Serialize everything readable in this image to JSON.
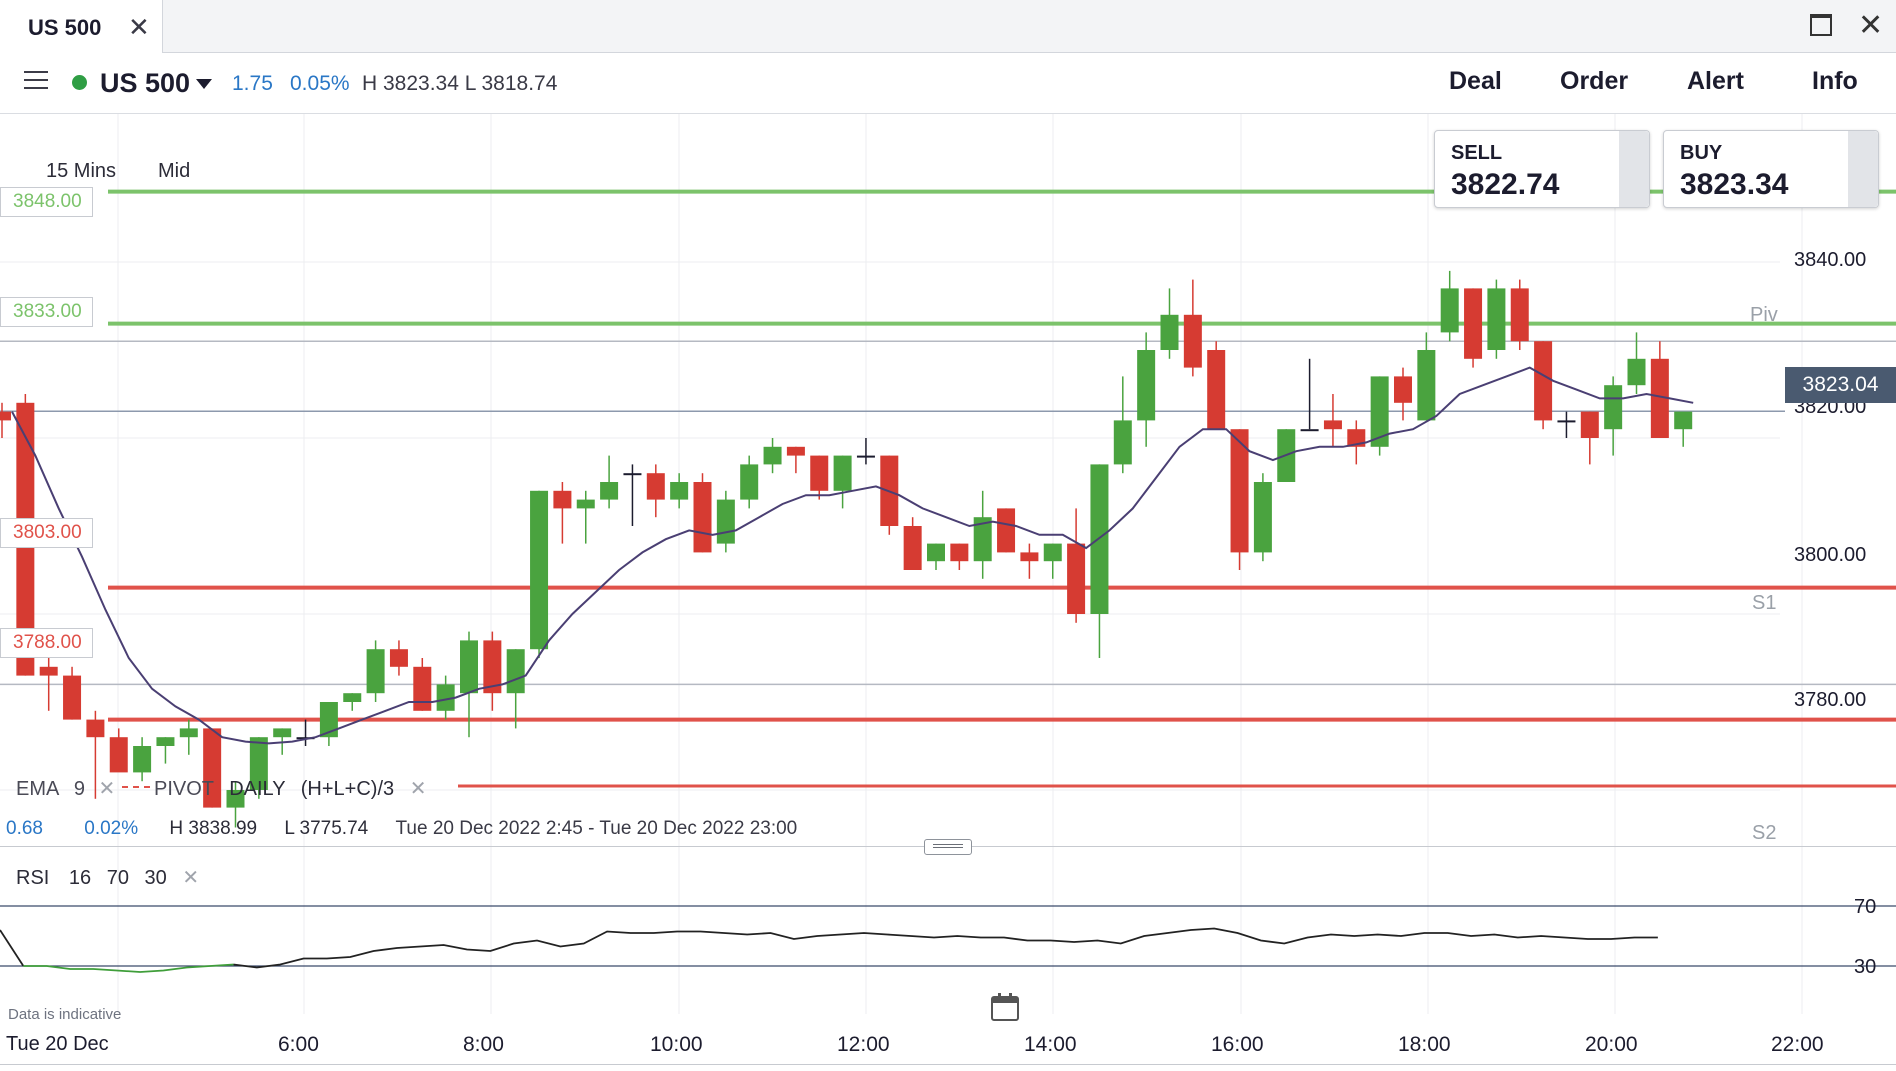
{
  "tab": {
    "title": "US 500"
  },
  "header": {
    "instrument": "US 500",
    "change_points": "1.75",
    "change_percent": "0.05%",
    "high_low": "H 3823.34 L 3818.74",
    "actions": [
      "Deal",
      "Order",
      "Alert",
      "Info"
    ]
  },
  "chart_toolbar": {
    "interval": "15 Mins",
    "price_type": "Mid"
  },
  "tickets": {
    "sell": {
      "label": "SELL",
      "price": "3822.74"
    },
    "buy": {
      "label": "BUY",
      "price": "3823.34"
    }
  },
  "levels": {
    "green": [
      "3848.00",
      "3833.00"
    ],
    "red": [
      "3803.00",
      "3788.00"
    ],
    "pivots": [
      "Piv",
      "S1",
      "S2"
    ]
  },
  "current_price": "3823.04",
  "price_axis": [
    "3840.00",
    "3820.00",
    "3800.00",
    "3780.00"
  ],
  "indicators": {
    "ema": {
      "name": "EMA",
      "period": "9"
    },
    "pivot": {
      "name": "PIVOT",
      "period": "DAILY",
      "formula": "(H+L+C)/3"
    }
  },
  "stats": {
    "change": "0.68",
    "change_pct": "0.02%",
    "high": "H 3838.99",
    "low": "L 3775.74",
    "range": "Tue 20 Dec 2022 2:45 - Tue 20 Dec 2022 23:00"
  },
  "rsi": {
    "name": "RSI",
    "params": [
      "16",
      "70",
      "30"
    ],
    "levels": [
      "70",
      "30"
    ]
  },
  "footer": {
    "note": "Data is indicative",
    "date": "Tue 20 Dec",
    "times": [
      "6:00",
      "8:00",
      "10:00",
      "12:00",
      "14:00",
      "16:00",
      "18:00",
      "20:00",
      "22:00"
    ]
  },
  "colors": {
    "up": "#4aa33f",
    "down": "#d63b32",
    "green_level": "#7cc36b",
    "red_level": "#e0524a",
    "ema": "#4a3f73",
    "rsi": "#222222",
    "rsi_low": "#3f9e3a",
    "accent_blue": "#2a77c6"
  },
  "chart_data": {
    "type": "candlestick",
    "interval": "15 Mins",
    "ylim": [
      3762,
      3852
    ],
    "candles": [
      {
        "o": 3823,
        "h": 3824,
        "l": 3820,
        "c": 3822
      },
      {
        "o": 3824,
        "h": 3825,
        "l": 3793,
        "c": 3793
      },
      {
        "o": 3794,
        "h": 3796,
        "l": 3789,
        "c": 3793
      },
      {
        "o": 3793,
        "h": 3794,
        "l": 3788,
        "c": 3788
      },
      {
        "o": 3788,
        "h": 3789,
        "l": 3779,
        "c": 3786
      },
      {
        "o": 3786,
        "h": 3787,
        "l": 3783,
        "c": 3782
      },
      {
        "o": 3782,
        "h": 3786,
        "l": 3781,
        "c": 3785
      },
      {
        "o": 3785,
        "h": 3786,
        "l": 3783,
        "c": 3786
      },
      {
        "o": 3786,
        "h": 3788,
        "l": 3784,
        "c": 3787
      },
      {
        "o": 3787,
        "h": 3787,
        "l": 3778,
        "c": 3778
      },
      {
        "o": 3778,
        "h": 3781,
        "l": 3775.74,
        "c": 3780
      },
      {
        "o": 3780,
        "h": 3786,
        "l": 3779,
        "c": 3786
      },
      {
        "o": 3786,
        "h": 3787,
        "l": 3784,
        "c": 3787
      },
      {
        "o": 3786,
        "h": 3788,
        "l": 3785,
        "c": 3786
      },
      {
        "o": 3786,
        "h": 3790,
        "l": 3785,
        "c": 3790
      },
      {
        "o": 3790,
        "h": 3791,
        "l": 3789,
        "c": 3791
      },
      {
        "o": 3791,
        "h": 3797,
        "l": 3790,
        "c": 3796
      },
      {
        "o": 3796,
        "h": 3797,
        "l": 3793,
        "c": 3794
      },
      {
        "o": 3794,
        "h": 3795,
        "l": 3789,
        "c": 3789
      },
      {
        "o": 3789,
        "h": 3793,
        "l": 3788,
        "c": 3792
      },
      {
        "o": 3791,
        "h": 3798,
        "l": 3786,
        "c": 3797
      },
      {
        "o": 3797,
        "h": 3798,
        "l": 3789,
        "c": 3791
      },
      {
        "o": 3791,
        "h": 3796,
        "l": 3787,
        "c": 3796
      },
      {
        "o": 3796,
        "h": 3814,
        "l": 3795,
        "c": 3814
      },
      {
        "o": 3814,
        "h": 3815,
        "l": 3808,
        "c": 3812
      },
      {
        "o": 3812,
        "h": 3814,
        "l": 3808,
        "c": 3813
      },
      {
        "o": 3813,
        "h": 3818,
        "l": 3812,
        "c": 3815
      },
      {
        "o": 3816,
        "h": 3817,
        "l": 3810,
        "c": 3816
      },
      {
        "o": 3816,
        "h": 3817,
        "l": 3811,
        "c": 3813
      },
      {
        "o": 3813,
        "h": 3816,
        "l": 3812,
        "c": 3815
      },
      {
        "o": 3815,
        "h": 3816,
        "l": 3807,
        "c": 3807
      },
      {
        "o": 3808,
        "h": 3814,
        "l": 3807,
        "c": 3813
      },
      {
        "o": 3813,
        "h": 3818,
        "l": 3812,
        "c": 3817
      },
      {
        "o": 3817,
        "h": 3820,
        "l": 3816,
        "c": 3819
      },
      {
        "o": 3819,
        "h": 3819,
        "l": 3816,
        "c": 3818
      },
      {
        "o": 3818,
        "h": 3818,
        "l": 3813,
        "c": 3814
      },
      {
        "o": 3814,
        "h": 3818,
        "l": 3812,
        "c": 3818
      },
      {
        "o": 3818,
        "h": 3820,
        "l": 3817,
        "c": 3818
      },
      {
        "o": 3818,
        "h": 3818,
        "l": 3809,
        "c": 3810
      },
      {
        "o": 3810,
        "h": 3811,
        "l": 3805,
        "c": 3805
      },
      {
        "o": 3806,
        "h": 3808,
        "l": 3805,
        "c": 3808
      },
      {
        "o": 3808,
        "h": 3808,
        "l": 3805,
        "c": 3806
      },
      {
        "o": 3806,
        "h": 3814,
        "l": 3804,
        "c": 3811
      },
      {
        "o": 3812,
        "h": 3812,
        "l": 3807,
        "c": 3807
      },
      {
        "o": 3807,
        "h": 3808,
        "l": 3804,
        "c": 3806
      },
      {
        "o": 3806,
        "h": 3808,
        "l": 3804,
        "c": 3808
      },
      {
        "o": 3808,
        "h": 3812,
        "l": 3799,
        "c": 3800
      },
      {
        "o": 3800,
        "h": 3817,
        "l": 3795,
        "c": 3817
      },
      {
        "o": 3817,
        "h": 3827,
        "l": 3816,
        "c": 3822
      },
      {
        "o": 3822,
        "h": 3832,
        "l": 3819,
        "c": 3830
      },
      {
        "o": 3830,
        "h": 3837,
        "l": 3829,
        "c": 3834
      },
      {
        "o": 3834,
        "h": 3838,
        "l": 3827,
        "c": 3828
      },
      {
        "o": 3830,
        "h": 3831,
        "l": 3821,
        "c": 3821
      },
      {
        "o": 3821,
        "h": 3821,
        "l": 3805,
        "c": 3807
      },
      {
        "o": 3807,
        "h": 3816,
        "l": 3806,
        "c": 3815
      },
      {
        "o": 3815,
        "h": 3821,
        "l": 3815,
        "c": 3821
      },
      {
        "o": 3821,
        "h": 3829,
        "l": 3821,
        "c": 3821
      },
      {
        "o": 3822,
        "h": 3825,
        "l": 3819,
        "c": 3821
      },
      {
        "o": 3821,
        "h": 3822,
        "l": 3817,
        "c": 3819
      },
      {
        "o": 3819,
        "h": 3827,
        "l": 3818,
        "c": 3827
      },
      {
        "o": 3827,
        "h": 3828,
        "l": 3822,
        "c": 3824
      },
      {
        "o": 3822,
        "h": 3832,
        "l": 3822,
        "c": 3830
      },
      {
        "o": 3832,
        "h": 3838.99,
        "l": 3831,
        "c": 3837
      },
      {
        "o": 3837,
        "h": 3837,
        "l": 3828,
        "c": 3829
      },
      {
        "o": 3830,
        "h": 3838,
        "l": 3829,
        "c": 3837
      },
      {
        "o": 3837,
        "h": 3838,
        "l": 3830,
        "c": 3831
      },
      {
        "o": 3831,
        "h": 3831,
        "l": 3821,
        "c": 3822
      },
      {
        "o": 3822,
        "h": 3823,
        "l": 3820,
        "c": 3822
      },
      {
        "o": 3823,
        "h": 3823,
        "l": 3817,
        "c": 3820
      },
      {
        "o": 3821,
        "h": 3827,
        "l": 3818,
        "c": 3826
      },
      {
        "o": 3826,
        "h": 3832,
        "l": 3825,
        "c": 3829
      },
      {
        "o": 3829,
        "h": 3831,
        "l": 3821,
        "c": 3820
      },
      {
        "o": 3821,
        "h": 3822,
        "l": 3819,
        "c": 3823
      }
    ],
    "ema_9": [
      3823,
      3818,
      3812,
      3806.5,
      3800.5,
      3795,
      3791.5,
      3789.5,
      3788,
      3786,
      3785.5,
      3785.3,
      3785.5,
      3786,
      3787,
      3788,
      3789,
      3790,
      3790,
      3790.5,
      3791.5,
      3792,
      3793,
      3797,
      3800,
      3802.5,
      3805,
      3807,
      3808.5,
      3809.5,
      3809,
      3809.5,
      3811,
      3812.5,
      3813.5,
      3813.5,
      3814,
      3814.5,
      3813.5,
      3812,
      3811,
      3810,
      3810.5,
      3810,
      3809,
      3809,
      3807.5,
      3809.5,
      3812,
      3815.5,
      3819,
      3821,
      3821,
      3818.5,
      3817.5,
      3818.5,
      3819,
      3819,
      3819.5,
      3820.5,
      3821,
      3822.5,
      3825,
      3826,
      3827,
      3828,
      3826.5,
      3825.5,
      3824.5,
      3824.5,
      3825,
      3824.5,
      3824
    ],
    "pivot_levels": {
      "Piv": 3831,
      "S1": 3792,
      "S2": 3771
    },
    "rsi_16": [
      54,
      30,
      30,
      28,
      28,
      27,
      26,
      27,
      29,
      30,
      31,
      29,
      31,
      35,
      35,
      36,
      40,
      42,
      43,
      44,
      41,
      40,
      45,
      47,
      43,
      45,
      53,
      52,
      52,
      53,
      53,
      52,
      51,
      52,
      48,
      50,
      51,
      52,
      51,
      50,
      49,
      50,
      49,
      49,
      47,
      47,
      46,
      47,
      45,
      50,
      52,
      54,
      55,
      52,
      47,
      45,
      49,
      51,
      50,
      51,
      50,
      52,
      52,
      50,
      51,
      49,
      50,
      49,
      48,
      48,
      49,
      49
    ],
    "rsi_levels": [
      70,
      30
    ],
    "x_labels": [
      "6:00",
      "8:00",
      "10:00",
      "12:00",
      "14:00",
      "16:00",
      "18:00",
      "20:00",
      "22:00"
    ]
  }
}
